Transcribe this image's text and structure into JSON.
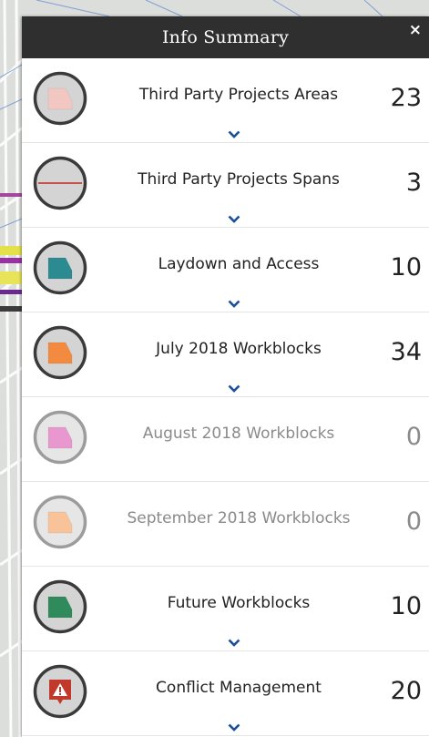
{
  "header": {
    "title": "Info Summary",
    "close_label": "×"
  },
  "colors": {
    "header_bg": "#2f2f2f",
    "chevron": "#1b4f9a",
    "icon_ring": "#3a3a3a",
    "icon_ring_dim": "#9c9c9c",
    "icon_fill": "#d4d4d4"
  },
  "rows": [
    {
      "label": "Third Party Projects Areas",
      "count": "23",
      "icon": "polygon-pink-icon",
      "symbol_color": "#f2c7c2",
      "dim": false
    },
    {
      "label": "Third Party Projects Spans",
      "count": "3",
      "icon": "line-red-icon",
      "symbol_color": "#c5524d",
      "dim": false
    },
    {
      "label": "Laydown and Access",
      "count": "10",
      "icon": "polygon-teal-icon",
      "symbol_color": "#2b8b91",
      "dim": false
    },
    {
      "label": "July 2018 Workblocks",
      "count": "34",
      "icon": "polygon-orange-icon",
      "symbol_color": "#f28a3f",
      "dim": false
    },
    {
      "label": "August 2018 Workblocks",
      "count": "0",
      "icon": "polygon-magenta-icon",
      "symbol_color": "#e898cf",
      "dim": true
    },
    {
      "label": "September 2018 Workblocks",
      "count": "0",
      "icon": "polygon-peach-icon",
      "symbol_color": "#f9c39a",
      "dim": true
    },
    {
      "label": "Future Workblocks",
      "count": "10",
      "icon": "polygon-green-icon",
      "symbol_color": "#2f8a5c",
      "dim": false
    },
    {
      "label": "Conflict Management",
      "count": "20",
      "icon": "warning-icon",
      "symbol_color": "#c0392b",
      "dim": false
    }
  ]
}
